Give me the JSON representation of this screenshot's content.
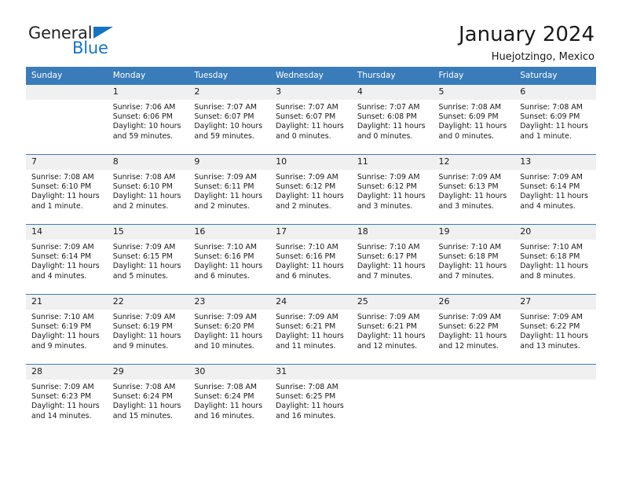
{
  "brand": {
    "name_top": "General",
    "name_bottom": "Blue",
    "triangle_color": "#1674c2"
  },
  "header": {
    "title": "January 2024",
    "subtitle": "Huejotzingo, Mexico"
  },
  "theme": {
    "header_row_bg": "#3a7cba",
    "daynum_bg": "#f0f0f0",
    "text": "#1a1a1a"
  },
  "weekday_headers": [
    "Sunday",
    "Monday",
    "Tuesday",
    "Wednesday",
    "Thursday",
    "Friday",
    "Saturday"
  ],
  "weeks": [
    [
      {
        "day": "",
        "empty": true,
        "sunrise": "",
        "sunset": "",
        "daylight_1": "",
        "daylight_2": ""
      },
      {
        "day": "1",
        "sunrise": "Sunrise: 7:06 AM",
        "sunset": "Sunset: 6:06 PM",
        "daylight_1": "Daylight: 10 hours",
        "daylight_2": "and 59 minutes."
      },
      {
        "day": "2",
        "sunrise": "Sunrise: 7:07 AM",
        "sunset": "Sunset: 6:07 PM",
        "daylight_1": "Daylight: 10 hours",
        "daylight_2": "and 59 minutes."
      },
      {
        "day": "3",
        "sunrise": "Sunrise: 7:07 AM",
        "sunset": "Sunset: 6:07 PM",
        "daylight_1": "Daylight: 11 hours",
        "daylight_2": "and 0 minutes."
      },
      {
        "day": "4",
        "sunrise": "Sunrise: 7:07 AM",
        "sunset": "Sunset: 6:08 PM",
        "daylight_1": "Daylight: 11 hours",
        "daylight_2": "and 0 minutes."
      },
      {
        "day": "5",
        "sunrise": "Sunrise: 7:08 AM",
        "sunset": "Sunset: 6:09 PM",
        "daylight_1": "Daylight: 11 hours",
        "daylight_2": "and 0 minutes."
      },
      {
        "day": "6",
        "sunrise": "Sunrise: 7:08 AM",
        "sunset": "Sunset: 6:09 PM",
        "daylight_1": "Daylight: 11 hours",
        "daylight_2": "and 1 minute."
      }
    ],
    [
      {
        "day": "7",
        "sunrise": "Sunrise: 7:08 AM",
        "sunset": "Sunset: 6:10 PM",
        "daylight_1": "Daylight: 11 hours",
        "daylight_2": "and 1 minute."
      },
      {
        "day": "8",
        "sunrise": "Sunrise: 7:08 AM",
        "sunset": "Sunset: 6:10 PM",
        "daylight_1": "Daylight: 11 hours",
        "daylight_2": "and 2 minutes."
      },
      {
        "day": "9",
        "sunrise": "Sunrise: 7:09 AM",
        "sunset": "Sunset: 6:11 PM",
        "daylight_1": "Daylight: 11 hours",
        "daylight_2": "and 2 minutes."
      },
      {
        "day": "10",
        "sunrise": "Sunrise: 7:09 AM",
        "sunset": "Sunset: 6:12 PM",
        "daylight_1": "Daylight: 11 hours",
        "daylight_2": "and 2 minutes."
      },
      {
        "day": "11",
        "sunrise": "Sunrise: 7:09 AM",
        "sunset": "Sunset: 6:12 PM",
        "daylight_1": "Daylight: 11 hours",
        "daylight_2": "and 3 minutes."
      },
      {
        "day": "12",
        "sunrise": "Sunrise: 7:09 AM",
        "sunset": "Sunset: 6:13 PM",
        "daylight_1": "Daylight: 11 hours",
        "daylight_2": "and 3 minutes."
      },
      {
        "day": "13",
        "sunrise": "Sunrise: 7:09 AM",
        "sunset": "Sunset: 6:14 PM",
        "daylight_1": "Daylight: 11 hours",
        "daylight_2": "and 4 minutes."
      }
    ],
    [
      {
        "day": "14",
        "sunrise": "Sunrise: 7:09 AM",
        "sunset": "Sunset: 6:14 PM",
        "daylight_1": "Daylight: 11 hours",
        "daylight_2": "and 4 minutes."
      },
      {
        "day": "15",
        "sunrise": "Sunrise: 7:09 AM",
        "sunset": "Sunset: 6:15 PM",
        "daylight_1": "Daylight: 11 hours",
        "daylight_2": "and 5 minutes."
      },
      {
        "day": "16",
        "sunrise": "Sunrise: 7:10 AM",
        "sunset": "Sunset: 6:16 PM",
        "daylight_1": "Daylight: 11 hours",
        "daylight_2": "and 6 minutes."
      },
      {
        "day": "17",
        "sunrise": "Sunrise: 7:10 AM",
        "sunset": "Sunset: 6:16 PM",
        "daylight_1": "Daylight: 11 hours",
        "daylight_2": "and 6 minutes."
      },
      {
        "day": "18",
        "sunrise": "Sunrise: 7:10 AM",
        "sunset": "Sunset: 6:17 PM",
        "daylight_1": "Daylight: 11 hours",
        "daylight_2": "and 7 minutes."
      },
      {
        "day": "19",
        "sunrise": "Sunrise: 7:10 AM",
        "sunset": "Sunset: 6:18 PM",
        "daylight_1": "Daylight: 11 hours",
        "daylight_2": "and 7 minutes."
      },
      {
        "day": "20",
        "sunrise": "Sunrise: 7:10 AM",
        "sunset": "Sunset: 6:18 PM",
        "daylight_1": "Daylight: 11 hours",
        "daylight_2": "and 8 minutes."
      }
    ],
    [
      {
        "day": "21",
        "sunrise": "Sunrise: 7:10 AM",
        "sunset": "Sunset: 6:19 PM",
        "daylight_1": "Daylight: 11 hours",
        "daylight_2": "and 9 minutes."
      },
      {
        "day": "22",
        "sunrise": "Sunrise: 7:09 AM",
        "sunset": "Sunset: 6:19 PM",
        "daylight_1": "Daylight: 11 hours",
        "daylight_2": "and 9 minutes."
      },
      {
        "day": "23",
        "sunrise": "Sunrise: 7:09 AM",
        "sunset": "Sunset: 6:20 PM",
        "daylight_1": "Daylight: 11 hours",
        "daylight_2": "and 10 minutes."
      },
      {
        "day": "24",
        "sunrise": "Sunrise: 7:09 AM",
        "sunset": "Sunset: 6:21 PM",
        "daylight_1": "Daylight: 11 hours",
        "daylight_2": "and 11 minutes."
      },
      {
        "day": "25",
        "sunrise": "Sunrise: 7:09 AM",
        "sunset": "Sunset: 6:21 PM",
        "daylight_1": "Daylight: 11 hours",
        "daylight_2": "and 12 minutes."
      },
      {
        "day": "26",
        "sunrise": "Sunrise: 7:09 AM",
        "sunset": "Sunset: 6:22 PM",
        "daylight_1": "Daylight: 11 hours",
        "daylight_2": "and 12 minutes."
      },
      {
        "day": "27",
        "sunrise": "Sunrise: 7:09 AM",
        "sunset": "Sunset: 6:22 PM",
        "daylight_1": "Daylight: 11 hours",
        "daylight_2": "and 13 minutes."
      }
    ],
    [
      {
        "day": "28",
        "sunrise": "Sunrise: 7:09 AM",
        "sunset": "Sunset: 6:23 PM",
        "daylight_1": "Daylight: 11 hours",
        "daylight_2": "and 14 minutes."
      },
      {
        "day": "29",
        "sunrise": "Sunrise: 7:08 AM",
        "sunset": "Sunset: 6:24 PM",
        "daylight_1": "Daylight: 11 hours",
        "daylight_2": "and 15 minutes."
      },
      {
        "day": "30",
        "sunrise": "Sunrise: 7:08 AM",
        "sunset": "Sunset: 6:24 PM",
        "daylight_1": "Daylight: 11 hours",
        "daylight_2": "and 16 minutes."
      },
      {
        "day": "31",
        "sunrise": "Sunrise: 7:08 AM",
        "sunset": "Sunset: 6:25 PM",
        "daylight_1": "Daylight: 11 hours",
        "daylight_2": "and 16 minutes."
      },
      {
        "day": "",
        "empty": true,
        "sunrise": "",
        "sunset": "",
        "daylight_1": "",
        "daylight_2": ""
      },
      {
        "day": "",
        "empty": true,
        "sunrise": "",
        "sunset": "",
        "daylight_1": "",
        "daylight_2": ""
      },
      {
        "day": "",
        "empty": true,
        "sunrise": "",
        "sunset": "",
        "daylight_1": "",
        "daylight_2": ""
      }
    ]
  ]
}
